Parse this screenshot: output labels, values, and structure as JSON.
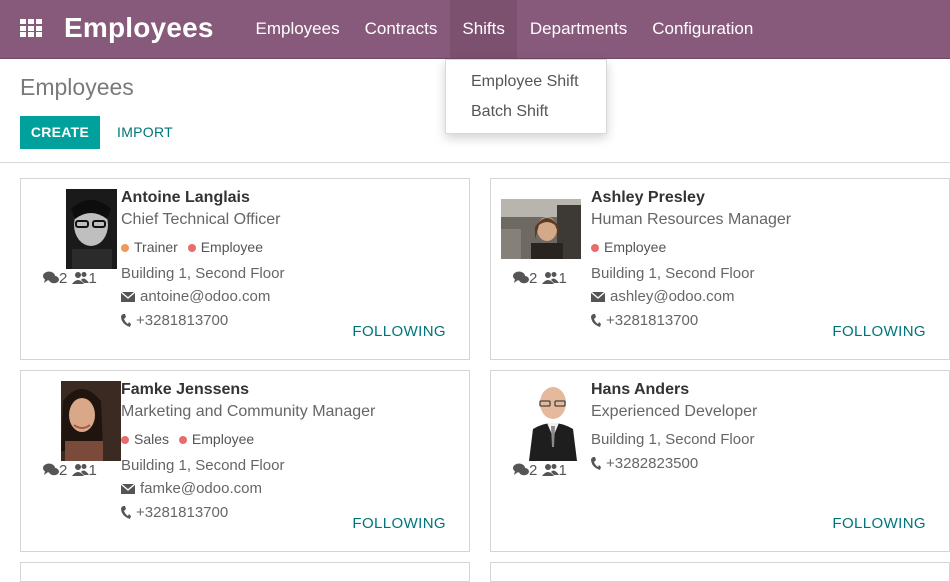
{
  "app": {
    "title": "Employees"
  },
  "menu": {
    "items": [
      {
        "label": "Employees",
        "active": false
      },
      {
        "label": "Contracts",
        "active": false
      },
      {
        "label": "Shifts",
        "active": true
      },
      {
        "label": "Departments",
        "active": false
      },
      {
        "label": "Configuration",
        "active": false
      }
    ],
    "dropdown": [
      "Employee Shift",
      "Batch Shift"
    ]
  },
  "page": {
    "title": "Employees",
    "create_label": "CREATE",
    "import_label": "IMPORT"
  },
  "employees": [
    {
      "name": "Antoine Langlais",
      "job": "Chief Technical Officer",
      "tags": [
        {
          "label": "Trainer",
          "color": "#f0975c"
        },
        {
          "label": "Employee",
          "color": "#e86c6c"
        }
      ],
      "location": "Building 1, Second Floor",
      "email": "antoine@odoo.com",
      "phone": "+3281813700",
      "messages": "2",
      "followers": "1",
      "follow_label": "FOLLOWING"
    },
    {
      "name": "Ashley Presley",
      "job": "Human Resources Manager",
      "tags": [
        {
          "label": "Employee",
          "color": "#e86c6c"
        }
      ],
      "location": "Building 1, Second Floor",
      "email": "ashley@odoo.com",
      "phone": "+3281813700",
      "messages": "2",
      "followers": "1",
      "follow_label": "FOLLOWING"
    },
    {
      "name": "Famke Jenssens",
      "job": "Marketing and Community Manager",
      "tags": [
        {
          "label": "Sales",
          "color": "#e86c6c"
        },
        {
          "label": "Employee",
          "color": "#e86c6c"
        }
      ],
      "location": "Building 1, Second Floor",
      "email": "famke@odoo.com",
      "phone": "+3281813700",
      "messages": "2",
      "followers": "1",
      "follow_label": "FOLLOWING"
    },
    {
      "name": "Hans Anders",
      "job": "Experienced Developer",
      "location": "Building 1, Second Floor",
      "phone": "+3282823500",
      "messages": "2",
      "followers": "1",
      "follow_label": "FOLLOWING"
    }
  ],
  "colors": {
    "brand": "#875a7b",
    "accent": "#00a09d",
    "link": "#00747a"
  }
}
